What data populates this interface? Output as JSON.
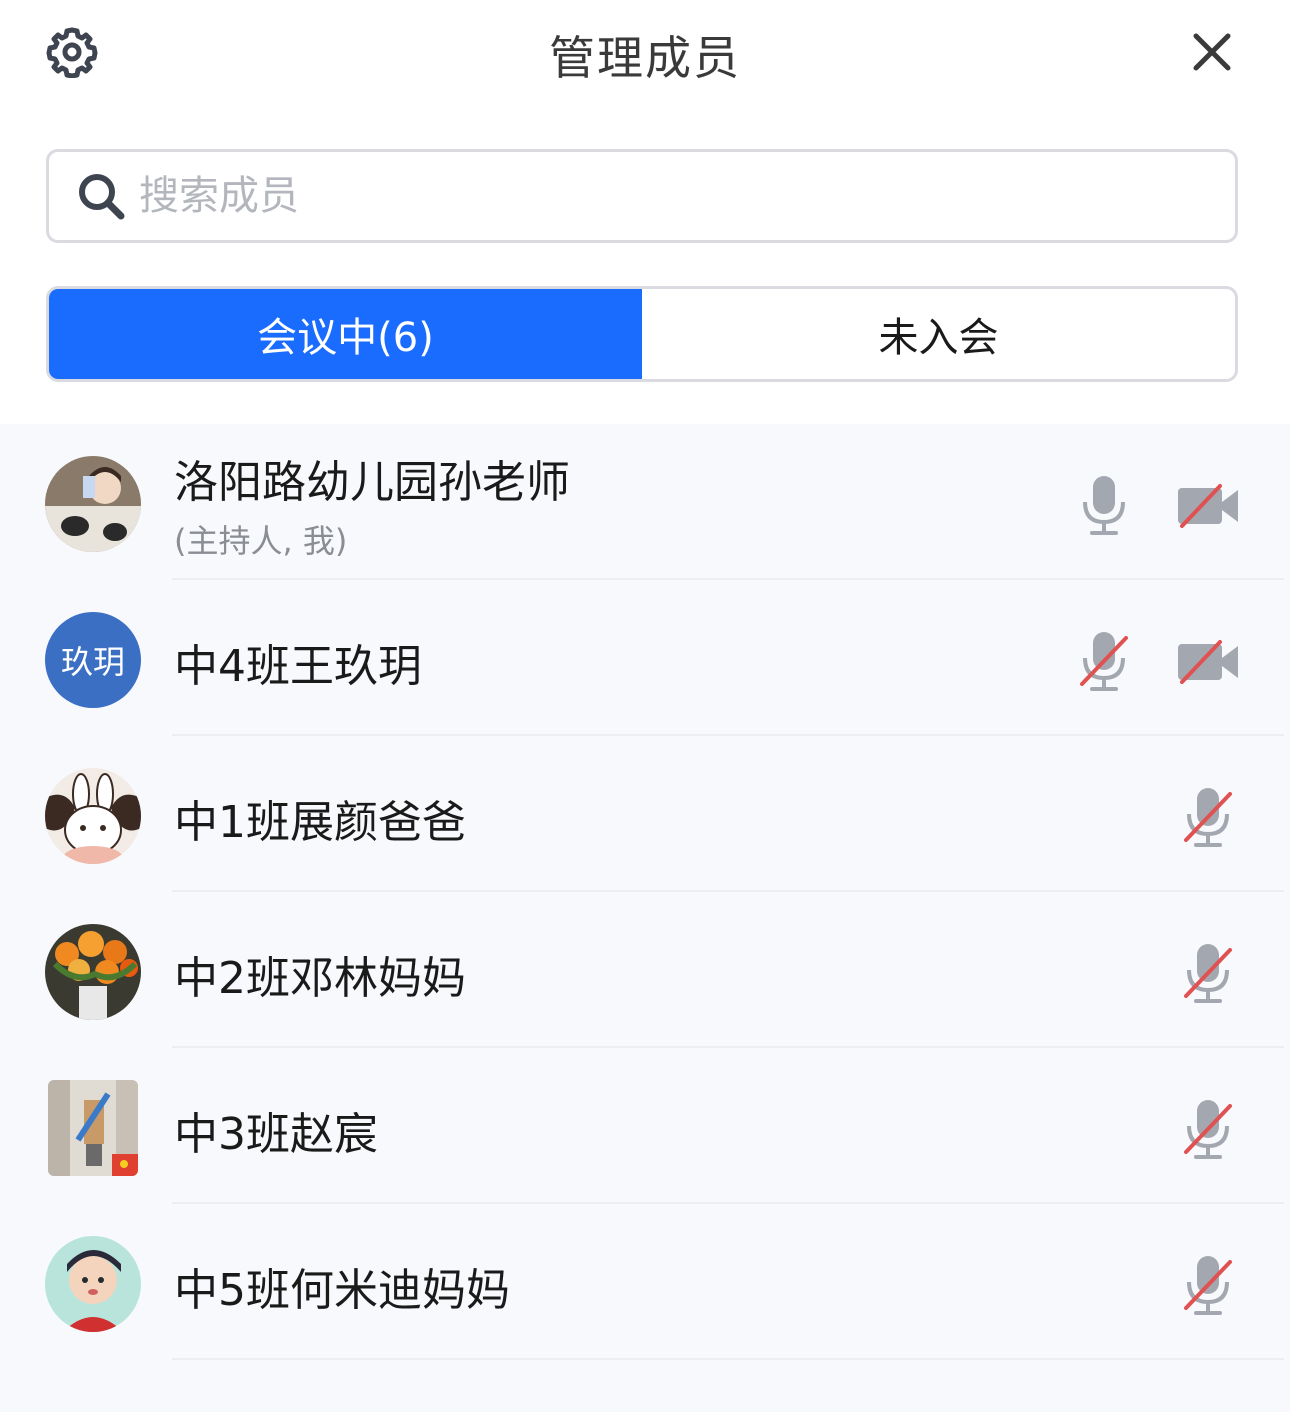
{
  "header": {
    "title": "管理成员",
    "settings_icon": "gear-icon",
    "close_icon": "close-icon"
  },
  "search": {
    "placeholder": "搜索成员",
    "value": ""
  },
  "tabs": [
    {
      "label": "会议中(6)",
      "active": true
    },
    {
      "label": "未入会",
      "active": false
    }
  ],
  "members": [
    {
      "name": "洛阳路幼儿园孙老师",
      "role": "(主持人, 我)",
      "avatar": "photo",
      "mic": "on",
      "camera": "off"
    },
    {
      "name": "中4班王玖玥",
      "avatar_text": "玖玥",
      "avatar": "text",
      "mic": "muted",
      "camera": "off"
    },
    {
      "name": "中1班展颜爸爸",
      "avatar": "photo",
      "mic": "muted"
    },
    {
      "name": "中2班邓林妈妈",
      "avatar": "photo",
      "mic": "muted"
    },
    {
      "name": "中3班赵宸",
      "avatar": "photo",
      "mic": "muted"
    },
    {
      "name": "中5班何米迪妈妈",
      "avatar": "photo",
      "mic": "muted"
    }
  ],
  "colors": {
    "accent": "#1a6cff",
    "muted_slash": "#e05252",
    "icon_gray": "#9aa0a8"
  }
}
